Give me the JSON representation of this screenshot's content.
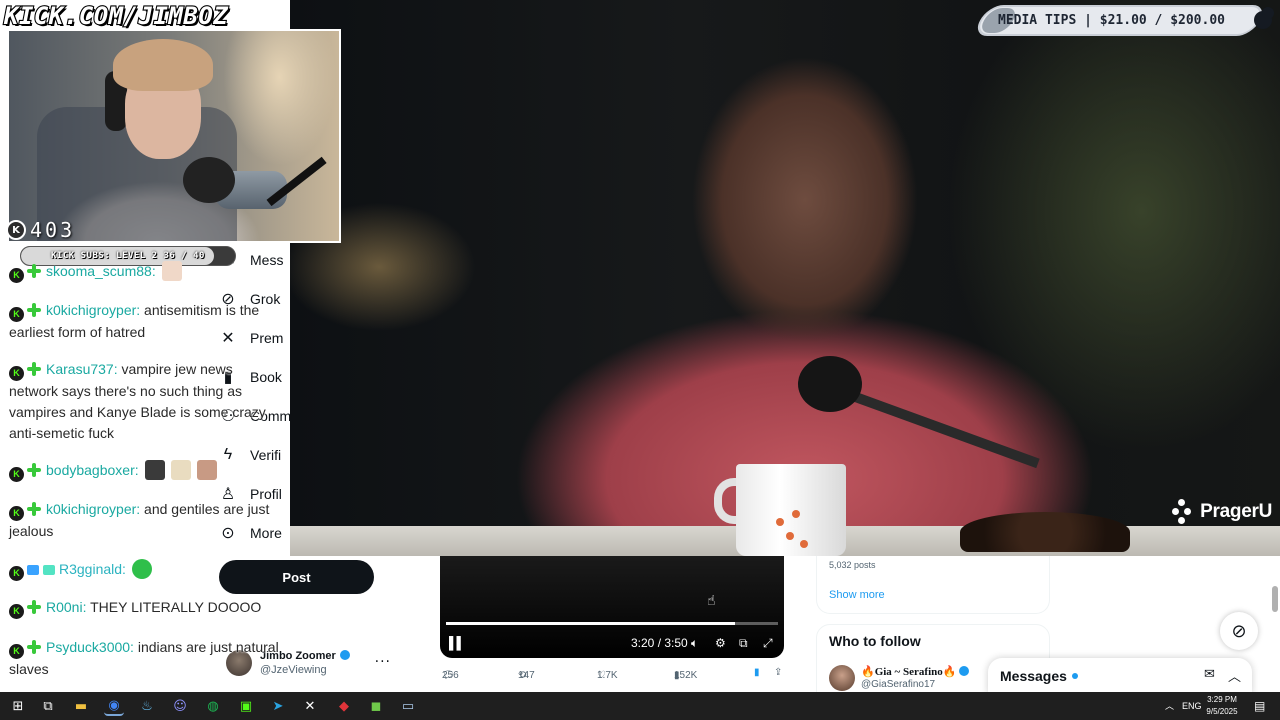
{
  "stream": {
    "url": "KICK.COM/JIMBOZ",
    "viewer_count": "403",
    "subs_goal": {
      "label": "KICK SUBS: LEVEL 2 36 / 40",
      "progress": 0.9
    },
    "media_tips": {
      "label": "MEDIA TIPS",
      "amount": "$21.00 / $200.00",
      "progress": 0.105
    }
  },
  "chat": {
    "messages": [
      {
        "user": "skooma_scum88:",
        "text": ""
      },
      {
        "user": "k0kichigroyper:",
        "text_line1": "antisemitism is the",
        "text_line2": "earliest form of hatred"
      },
      {
        "user": "Karasu737:",
        "text_line1": "vampire jew news",
        "text_line2": "network says there's no such thing as",
        "text_line3": "vampires and Kanye Blade is some crazy",
        "text_line4": "anti-semetic fuck"
      },
      {
        "user": "bodybagboxer:",
        "text": ""
      },
      {
        "user": "k0kichigroyper:",
        "text_line1": "and gentiles are just",
        "text_line2": "jealous"
      },
      {
        "user": "R3gginald:",
        "text": ""
      },
      {
        "user": "R00ni:",
        "text": "THEY LITERALLY DOOOO"
      },
      {
        "user": "Psyduck3000:",
        "text_line1": "indians are just natural",
        "text_line2": "slaves"
      }
    ]
  },
  "x_page": {
    "nav": [
      {
        "label": "Mess",
        "icon": "mail-icon"
      },
      {
        "label": "Grok",
        "icon": "grok-icon"
      },
      {
        "label": "Prem",
        "icon": "x-logo-icon"
      },
      {
        "label": "Book",
        "icon": "bookmark-icon"
      },
      {
        "label": "Comm",
        "icon": "communities-icon"
      },
      {
        "label": "Verifi",
        "icon": "lightning-icon"
      },
      {
        "label": "Profil",
        "icon": "person-icon"
      },
      {
        "label": "More",
        "icon": "more-circle-icon"
      }
    ],
    "post_label": "Post",
    "account": {
      "name": "Jimbo Zoomer",
      "handle": "@JzeViewing"
    },
    "video": {
      "time": "3:20 / 3:50",
      "progress": 0.87
    },
    "actions": {
      "replies": "256",
      "reposts": "147",
      "likes": "1.7K",
      "views": "152K"
    },
    "right_card": {
      "posts": "5,032 posts",
      "show_more": "Show more"
    },
    "who_to_follow": {
      "title": "Who to follow",
      "name": "🔥Gia ~ Serafino🔥",
      "handle": "@GiaSerafino17"
    },
    "messages_label": "Messages"
  },
  "main_video": {
    "brand": "PragerU"
  },
  "taskbar": {
    "lang": "ENG",
    "time": "3:29 PM",
    "date": "9/5/2025"
  },
  "colors": {
    "kick_green": "#53fc18",
    "x_blue": "#1d9bf0",
    "chat_user": "#1aa9a1"
  }
}
